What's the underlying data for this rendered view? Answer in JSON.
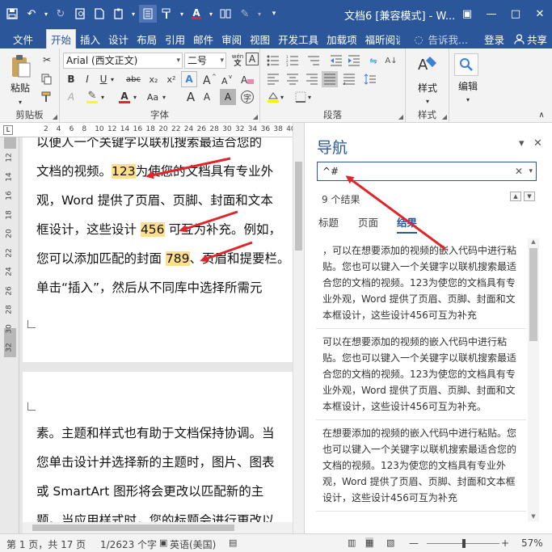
{
  "window": {
    "title": "文档6 [兼容模式] - W...",
    "minimize": "—",
    "maximize": "□",
    "close": "✕",
    "restore": "▣"
  },
  "tabs": {
    "file": "文件",
    "items": [
      "开始",
      "插入",
      "设计",
      "布局",
      "引用",
      "邮件",
      "审阅",
      "视图",
      "开发工具",
      "加载项",
      "福昕阅读"
    ],
    "tell_me": "告诉我...",
    "signin": "登录",
    "share": "共享"
  },
  "ribbon": {
    "clipboard": {
      "paste": "粘贴",
      "label": "剪贴板"
    },
    "font": {
      "name": "Arial (西文正文)",
      "size": "二号",
      "label": "字体",
      "bold": "B",
      "italic": "I",
      "underline": "U",
      "strike": "abc",
      "sub": "x₂",
      "sup": "x²",
      "wen": "wén",
      "grow": "A",
      "shrink": "A",
      "clear": "A",
      "color_a": "A",
      "aa": "Aa",
      "hl_mark": "A",
      "ab": "A",
      "charborder": "A"
    },
    "paragraph": {
      "label": "段落"
    },
    "styles": {
      "button": "样式",
      "label": "样式"
    },
    "editing": {
      "button": "编辑"
    }
  },
  "ruler": {
    "ticks": [
      "2",
      "4",
      "6",
      "8",
      "10",
      "12",
      "14",
      "16",
      "18",
      "20",
      "22",
      "24",
      "26",
      "28",
      "30",
      "32",
      "34",
      "36",
      "38",
      "40"
    ],
    "vticks": [
      "12",
      "14",
      "16",
      "18",
      "20",
      "22",
      "24",
      "26",
      "28",
      "30",
      "32"
    ],
    "tab_marker": "L"
  },
  "document": {
    "page1_top": "以便人一个关键字以联机搜索最适合您的",
    "line1_pre": "文档的视频。",
    "line1_hl": "123",
    "line1_post": "为使您的文档具有专业外",
    "line2": "观，Word 提供了页眉、页脚、封面和文本",
    "line3_pre": "框设计，这些设计 ",
    "line3_hl": "456",
    "line3_post": " 可互为补充。例如，",
    "line4_pre": "您可以添加匹配的封面 ",
    "line4_hl": "789",
    "line4_post": "、页眉和提要栏。",
    "line5": "单击“插入”，然后从不同库中选择所需元",
    "page2_line1": "素。主题和样式也有助于文档保持协调。当",
    "page2_line2": "您单击设计并选择新的主题时，图片、图表",
    "page2_line3": "或 SmartArt 图形将会更改以匹配新的主",
    "page2_line4": "题。当应用样式时，您的标题会进行更改以"
  },
  "nav": {
    "title": "导航",
    "dropdown": "▾",
    "close": "✕",
    "search_value": "^#",
    "clear_x": "✕",
    "search_dd": "▾",
    "count": "9 个结果",
    "prev": "▲",
    "next": "▼",
    "tabs": [
      "标题",
      "页面",
      "结果"
    ],
    "results": [
      "，可以在想要添加的视频的嵌入代码中进行粘贴。您也可以键入一个关键字以联机搜索最适合您的文档的视频。123为使您的文档具有专业外观，Word 提供了页眉、页脚、封面和文本框设计，这些设计456可互为补充",
      "可以在想要添加的视频的嵌入代码中进行粘贴。您也可以键入一个关键字以联机搜索最适合您的文档的视频。123为使您的文档具有专业外观，Word 提供了页眉、页脚、封面和文本框设计，这些设计456可互为补充。",
      "在想要添加的视频的嵌入代码中进行粘贴。您也可以键入一个关键字以联机搜索最适合您的文档的视频。123为使您的文档具有专业外观，Word 提供了页眉、页脚、封面和文本框设计，这些设计456可互为补充"
    ]
  },
  "status": {
    "page": "第 1 页，共 17 页",
    "words": "1/2623 个字",
    "lang": "英语(美国)",
    "zoom_minus": "—",
    "zoom_plus": "+",
    "zoom": "57%"
  },
  "colors": {
    "brand": "#2b579a",
    "highlight": "#ffe08a",
    "arrow": "#e0262b"
  }
}
